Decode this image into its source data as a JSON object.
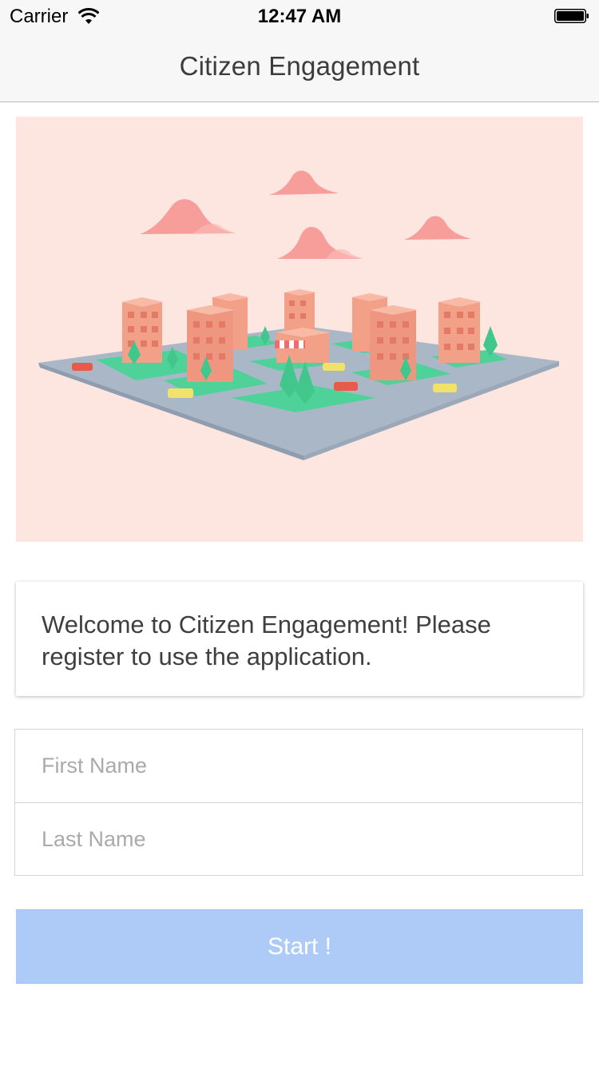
{
  "status_bar": {
    "carrier": "Carrier",
    "time": "12:47 AM",
    "wifi_icon": "wifi-icon",
    "battery_icon": "battery-icon"
  },
  "nav": {
    "title": "Citizen Engagement"
  },
  "hero": {
    "illustration": "isometric-city-illustration",
    "background_color": "#fde5e0"
  },
  "welcome": {
    "message": "Welcome to Citizen Engagement! Please register to use the application."
  },
  "form": {
    "first_name": {
      "value": "",
      "placeholder": "First Name"
    },
    "last_name": {
      "value": "",
      "placeholder": "Last Name"
    }
  },
  "start_button": {
    "label": "Start !",
    "color": "#aecbf8"
  }
}
